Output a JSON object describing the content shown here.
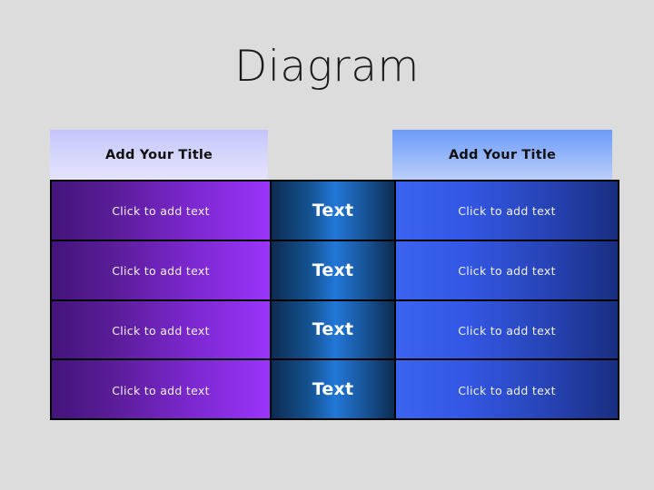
{
  "slide": {
    "title": "Diagram",
    "background_color": "#dcdcdc",
    "title_color": "#1a1a1a"
  },
  "headers": {
    "left": {
      "label": "Add Your Title",
      "gradient_from": "#c3c5fb",
      "gradient_to": "#e4e4fc",
      "text_color": "#111111"
    },
    "right": {
      "label": "Add Your Title",
      "gradient_from": "#6c9bf9",
      "gradient_to": "#bacef9",
      "text_color": "#111111"
    }
  },
  "table": {
    "columns": [
      {
        "name": "left-column",
        "style": "purple",
        "gradient_from": "#43147c",
        "gradient_to": "#9a35fb",
        "text_color": "#f2f2f7"
      },
      {
        "name": "middle-column",
        "style": "blue-center-highlight",
        "gradient_from": "#0d2b52",
        "gradient_mid": "#2277d8",
        "gradient_to": "#0c2b50",
        "text_color": "#ffffff"
      },
      {
        "name": "right-column",
        "style": "royal-blue",
        "gradient_from": "#3a64f0",
        "gradient_to": "#192e81",
        "text_color": "#f2f2f7"
      }
    ],
    "border_color": "#000000",
    "rows": [
      {
        "left": "Click to add text",
        "middle": "Text",
        "right": "Click to add text"
      },
      {
        "left": "Click to add text",
        "middle": "Text",
        "right": "Click to add text"
      },
      {
        "left": "Click to add text",
        "middle": "Text",
        "right": "Click to add text"
      },
      {
        "left": "Click to add text",
        "middle": "Text",
        "right": "Click to add text"
      }
    ]
  }
}
